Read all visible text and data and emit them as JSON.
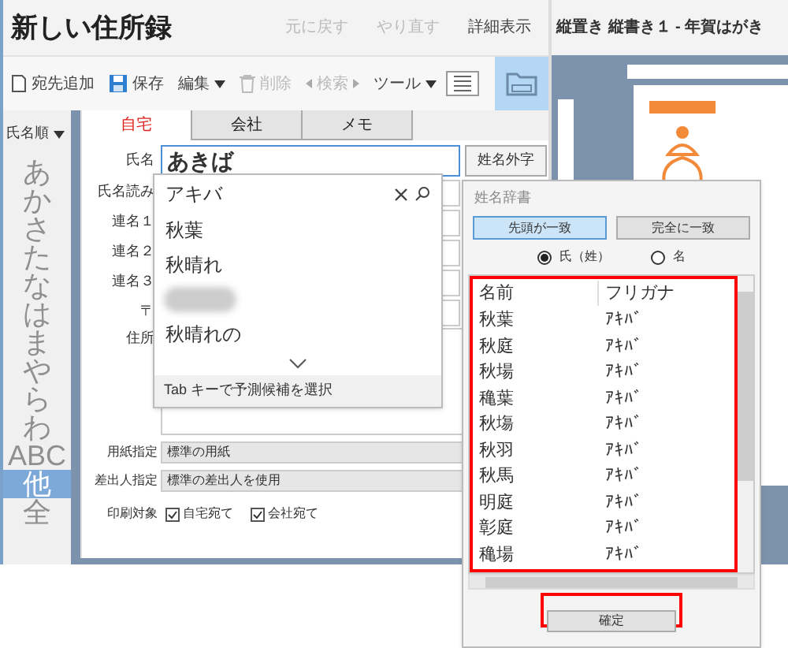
{
  "app": {
    "title": "新しい住所録",
    "header_actions": [
      {
        "label": "元に戻す",
        "disabled": true
      },
      {
        "label": "やり直す",
        "disabled": true
      },
      {
        "label": "詳細表示",
        "disabled": false
      }
    ],
    "toolbar": [
      {
        "label": "宛先追加",
        "kind": "doc",
        "disabled": false
      },
      {
        "label": "保存",
        "kind": "save",
        "disabled": false
      },
      {
        "label": "編集",
        "kind": "menu",
        "disabled": false
      },
      {
        "label": "削除",
        "kind": "trash",
        "disabled": true
      },
      {
        "label": "検索",
        "kind": "nav",
        "disabled": true
      },
      {
        "label": "ツール",
        "kind": "menu",
        "disabled": false
      }
    ],
    "sort": "氏名順",
    "index": [
      {
        "label": "あ",
        "selected": false
      },
      {
        "label": "か",
        "selected": false
      },
      {
        "label": "さ",
        "selected": false
      },
      {
        "label": "た",
        "selected": false
      },
      {
        "label": "な",
        "selected": false
      },
      {
        "label": "は",
        "selected": false
      },
      {
        "label": "ま",
        "selected": false
      },
      {
        "label": "や",
        "selected": false
      },
      {
        "label": "ら",
        "selected": false
      },
      {
        "label": "わ",
        "selected": false
      },
      {
        "label": "ABC",
        "selected": false
      },
      {
        "label": "他",
        "selected": true
      },
      {
        "label": "全",
        "selected": false
      }
    ],
    "tabs": [
      {
        "label": "自宅",
        "selected": true
      },
      {
        "label": "会社",
        "selected": false
      },
      {
        "label": "メモ",
        "selected": false
      }
    ],
    "name_field": {
      "label": "氏名",
      "value": "あきば",
      "button": "姓名外字"
    },
    "fields": [
      "氏名読み",
      "連名１",
      "連名２",
      "連名３",
      "〒"
    ],
    "address_label": "住所",
    "selects": [
      {
        "label": "用紙指定",
        "value": "標準の用紙"
      },
      {
        "label": "差出人指定",
        "value": "標準の差出人を使用"
      }
    ],
    "print_label": "印刷対象",
    "print_targets": [
      {
        "label": "自宅宛て",
        "checked": true
      },
      {
        "label": "会社宛て",
        "checked": true
      }
    ]
  },
  "autocomplete": {
    "query": "アキバ",
    "items": [
      {
        "text": "秋葉",
        "blurred": false
      },
      {
        "text": "秋晴れ",
        "blurred": false
      },
      {
        "blurred": true
      },
      {
        "text": "秋晴れの",
        "blurred": false
      }
    ],
    "hint": "Tab キーで予測候補を選択"
  },
  "preview": {
    "title": "縦置き 縦書き１ - 年賀はがき"
  },
  "dictionary": {
    "title": "姓名辞書",
    "match_buttons": [
      {
        "label": "先頭が一致",
        "selected": true
      },
      {
        "label": "完全に一致",
        "selected": false
      }
    ],
    "radios": [
      {
        "label": "氏（姓）",
        "selected": true
      },
      {
        "label": "名",
        "selected": false
      }
    ],
    "columns": [
      "名前",
      "フリガナ"
    ],
    "rows": [
      [
        "秋葉",
        "ｱｷﾊﾞ"
      ],
      [
        "秋庭",
        "ｱｷﾊﾞ"
      ],
      [
        "秋場",
        "ｱｷﾊﾞ"
      ],
      [
        "穐葉",
        "ｱｷﾊﾞ"
      ],
      [
        "秋塲",
        "ｱｷﾊﾞ"
      ],
      [
        "秋羽",
        "ｱｷﾊﾞ"
      ],
      [
        "秋馬",
        "ｱｷﾊﾞ"
      ],
      [
        "明庭",
        "ｱｷﾊﾞ"
      ],
      [
        "彰庭",
        "ｱｷﾊﾞ"
      ],
      [
        "穐場",
        "ｱｷﾊﾞ"
      ]
    ],
    "confirm": "確定"
  }
}
